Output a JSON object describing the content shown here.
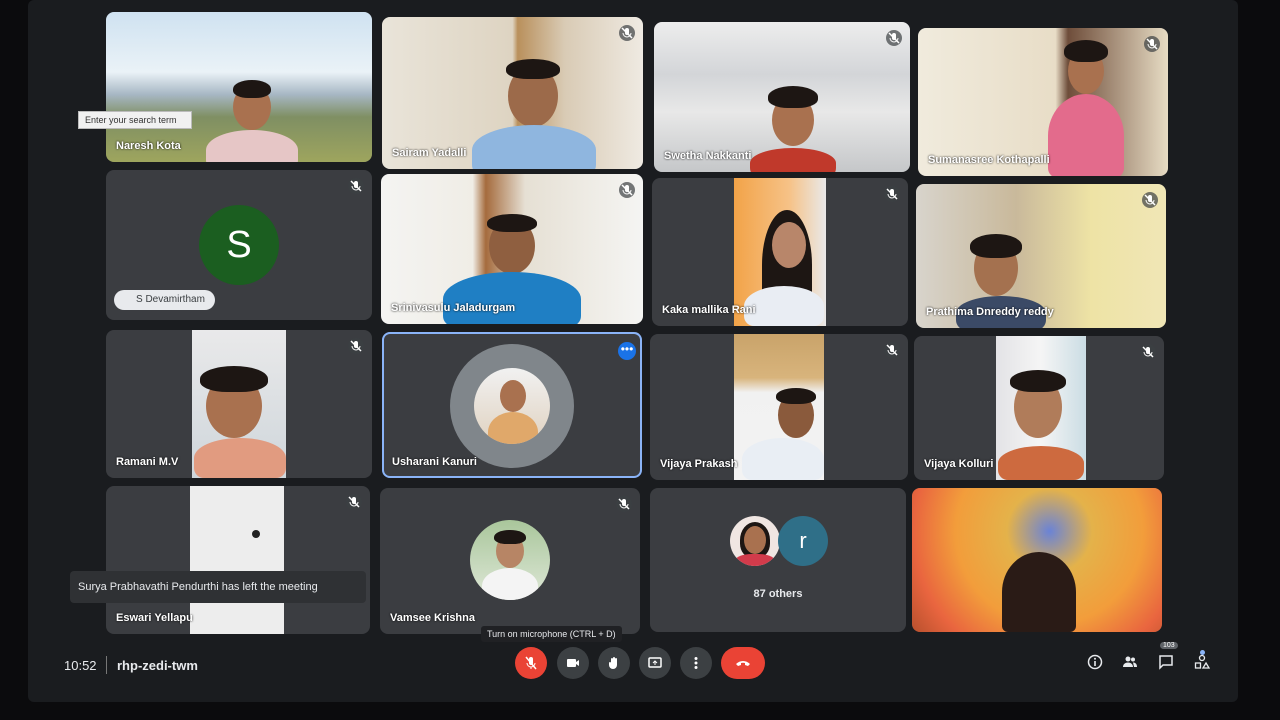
{
  "meeting": {
    "time": "10:52",
    "code": "rhp-zedi-twm"
  },
  "search": {
    "placeholder": "Enter your search term"
  },
  "participants": [
    {
      "name": "Naresh Kota"
    },
    {
      "name": "Sairam Yadalli"
    },
    {
      "name": "Swetha Nakkanti"
    },
    {
      "name": "Sumanasree Kothapalli"
    },
    {
      "name": "S Devamirtham",
      "initial": "S"
    },
    {
      "name": "Srinivasulu Jaladurgam"
    },
    {
      "name": "Kaka mallika Rani"
    },
    {
      "name": "Prathima Dnreddy reddy"
    },
    {
      "name": "Ramani M.V"
    },
    {
      "name": "Usharani Kanuri"
    },
    {
      "name": "Vijaya Prakash"
    },
    {
      "name": "Vijaya Kolluri"
    },
    {
      "name": "Eswari Yellapu"
    },
    {
      "name": "Vamsee Krishna"
    },
    {
      "name": "87 others",
      "initial": "r"
    }
  ],
  "notification": {
    "text": "Surya Prabhavathi Pendurthi has left the meeting"
  },
  "tooltip": {
    "text": "Turn on microphone (CTRL + D)"
  },
  "people_count": "103",
  "colors": {
    "background": "#1a1c1f",
    "tile": "#3b3d41",
    "leave_button": "#ea4335",
    "selected_border": "#8ab4f8",
    "avatar_s": "#1b5e20"
  },
  "icons": [
    "mic-off-icon",
    "camera-icon",
    "raise-hand-icon",
    "present-icon",
    "more-icon",
    "end-call-icon",
    "info-icon",
    "people-icon",
    "chat-icon",
    "activities-icon"
  ]
}
